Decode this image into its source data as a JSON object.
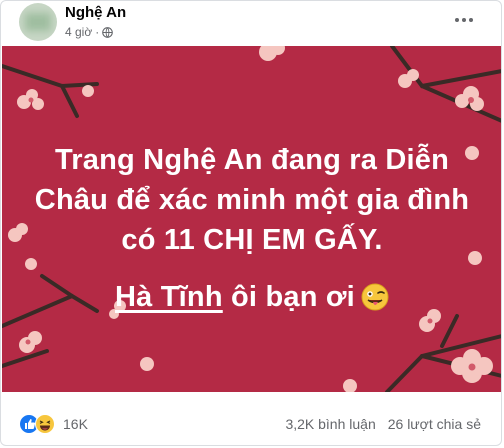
{
  "post": {
    "page_name": "Nghệ An",
    "time": "4 giờ",
    "separator": "·"
  },
  "image_text": {
    "line1": "Trang Nghệ An đang ra Diễn",
    "line2": "Châu để xác minh một gia đình",
    "line3": "có 11 CHỊ EM GẤY.",
    "line4_underlined": "Hà Tĩnh",
    "line4_rest": " ôi bạn ơi"
  },
  "reactions": {
    "count": "16K",
    "types": [
      "like-icon",
      "haha-icon"
    ]
  },
  "stats": {
    "comments": "3,2K bình luận",
    "shares": "26 lượt chia sẻ"
  },
  "colors": {
    "background_red": "#b42a45",
    "branch": "#3a2a26",
    "blossom": "#f5c6c0"
  }
}
